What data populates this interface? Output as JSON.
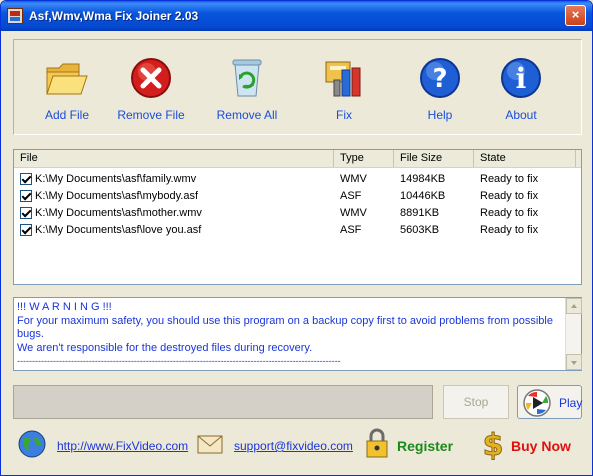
{
  "window": {
    "title": "Asf,Wmv,Wma Fix Joiner 2.03",
    "close_glyph": "×"
  },
  "toolbar": {
    "add_file": "Add File",
    "remove_file": "Remove File",
    "remove_all": "Remove All",
    "fix": "Fix",
    "help": "Help",
    "about": "About"
  },
  "grid": {
    "columns": [
      "File",
      "Type",
      "File Size",
      "State"
    ],
    "rows": [
      {
        "file": "K:\\My Documents\\asf\\family.wmv",
        "type": "WMV",
        "size": "14984KB",
        "state": "Ready to fix"
      },
      {
        "file": "K:\\My Documents\\asf\\mybody.asf",
        "type": "ASF",
        "size": "10446KB",
        "state": "Ready to fix"
      },
      {
        "file": "K:\\My Documents\\asf\\mother.wmv",
        "type": "WMV",
        "size": "8891KB",
        "state": "Ready to fix"
      },
      {
        "file": "K:\\My Documents\\asf\\love you.asf",
        "type": "ASF",
        "size": "5603KB",
        "state": "Ready to fix"
      }
    ]
  },
  "warning": {
    "line1": "!!! W A R N I N G !!!",
    "line2": "For your maximum safety, you should use this program on a backup copy first to avoid problems from possible bugs.",
    "line3": "We aren't responsible for the destroyed files during recovery.",
    "line4": "------------------------------------------------------------------------------------------------------------"
  },
  "controls": {
    "stop": "Stop",
    "play": "Play"
  },
  "footer": {
    "website": "http://www.FixVideo.com",
    "email": "support@fixvideo.com",
    "register": "Register",
    "buy_now": "Buy Now"
  },
  "colors": {
    "link_blue": "#1a35d8",
    "register_green": "#1a8a1a",
    "buy_red": "#e01010"
  }
}
